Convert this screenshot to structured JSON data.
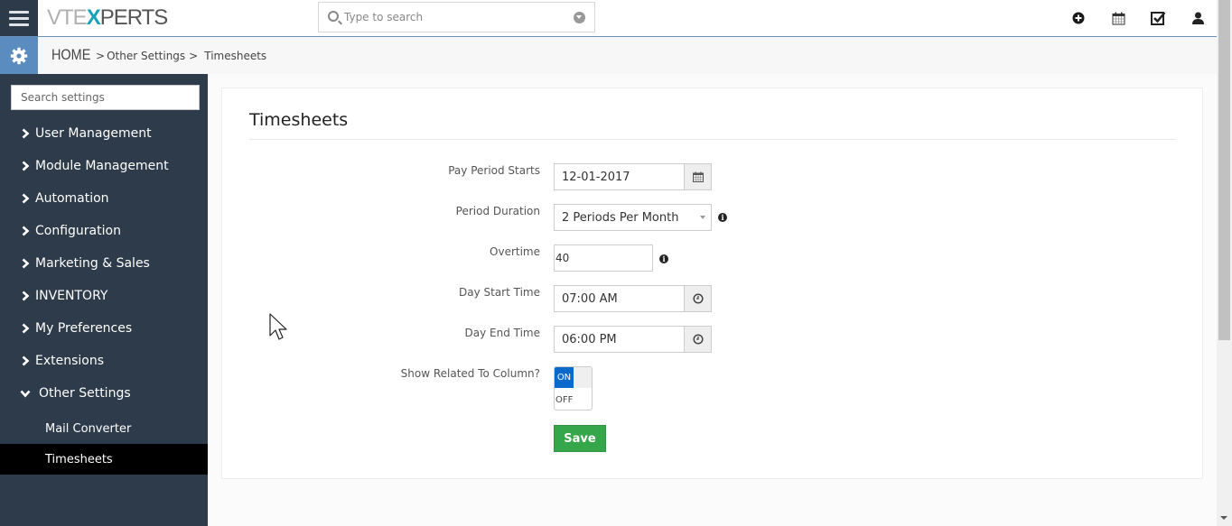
{
  "header": {
    "logo": {
      "part1": "VTE",
      "part2": "X",
      "part3": "PERTS"
    },
    "search_placeholder": "Type to search",
    "icons": [
      "plus-circle-icon",
      "calendar-icon",
      "checkbox-icon",
      "user-icon"
    ]
  },
  "breadcrumb": {
    "home": "HOME",
    "sep": ">",
    "items": [
      "Other Settings",
      "Timesheets"
    ]
  },
  "sidebar": {
    "search_placeholder": "Search settings",
    "items": [
      {
        "label": "User Management",
        "state": "collapsed"
      },
      {
        "label": "Module Management",
        "state": "collapsed"
      },
      {
        "label": "Automation",
        "state": "collapsed"
      },
      {
        "label": "Configuration",
        "state": "collapsed"
      },
      {
        "label": "Marketing & Sales",
        "state": "collapsed"
      },
      {
        "label": "INVENTORY",
        "state": "collapsed"
      },
      {
        "label": "My Preferences",
        "state": "collapsed"
      },
      {
        "label": "Extensions",
        "state": "collapsed"
      },
      {
        "label": "Other Settings",
        "state": "expanded"
      }
    ],
    "sub_items": [
      {
        "label": "Mail Converter",
        "active": false
      },
      {
        "label": "Timesheets",
        "active": true
      }
    ]
  },
  "main": {
    "title": "Timesheets",
    "form": {
      "pay_period_starts": {
        "label": "Pay Period Starts",
        "value": "12-01-2017"
      },
      "period_duration": {
        "label": "Period Duration",
        "value": "2 Periods Per Month"
      },
      "overtime": {
        "label": "Overtime",
        "value": "40"
      },
      "day_start_time": {
        "label": "Day Start Time",
        "value": "07:00 AM"
      },
      "day_end_time": {
        "label": "Day End Time",
        "value": "06:00 PM"
      },
      "show_related": {
        "label": "Show Related To Column?",
        "on_label": "ON",
        "off_label": "OFF",
        "value": "ON"
      }
    },
    "save_label": "Save",
    "info_glyph": "i"
  },
  "colors": {
    "sidebar_bg": "#2e3b4a",
    "accent_blue": "#5b8cbf",
    "toggle_on": "#0a6acb",
    "save_green": "#35a74a",
    "logo_x": "#1aa1b6"
  }
}
